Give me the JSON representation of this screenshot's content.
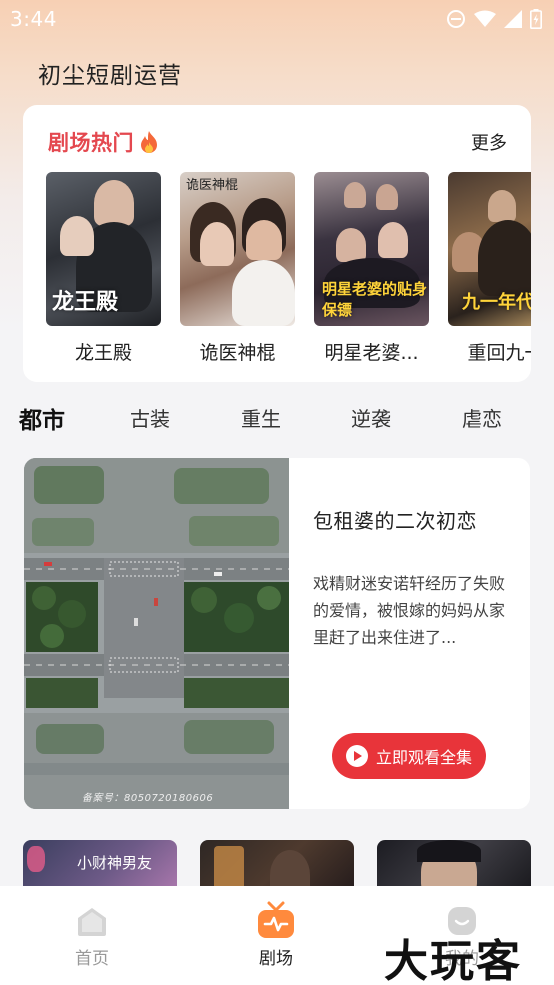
{
  "status_bar": {
    "time": "3:44"
  },
  "header": {
    "title": "初尘短剧运营"
  },
  "hot_section": {
    "title": "剧场热门",
    "more_label": "更多",
    "items": [
      {
        "name": "龙王殿",
        "poster_text": "龙王殿"
      },
      {
        "name": "诡医神棍",
        "poster_text": "诡医神棍"
      },
      {
        "name": "明星老婆...",
        "poster_text": "明星老婆的贴身保镖"
      },
      {
        "name": "重回九一",
        "poster_text": "九一年代"
      }
    ]
  },
  "tabs": [
    {
      "label": "都市",
      "active": true
    },
    {
      "label": "古装",
      "active": false
    },
    {
      "label": "重生",
      "active": false
    },
    {
      "label": "逆袭",
      "active": false
    },
    {
      "label": "虐恋",
      "active": false
    }
  ],
  "feature": {
    "title": "包租婆的二次初恋",
    "description": "戏精财迷安诺轩经历了失败的爱情，被恨嫁的妈妈从家里赶了出来住进了...",
    "button_label": "立即观看全集",
    "image_caption": "备案号：8050720180606"
  },
  "thumbs": [
    {
      "text": "小财神男友"
    },
    {
      "text": ""
    },
    {
      "text": ""
    }
  ],
  "bottom_nav": [
    {
      "label": "首页",
      "icon": "home-icon",
      "active": false
    },
    {
      "label": "剧场",
      "icon": "theater-icon",
      "active": true
    },
    {
      "label": "我的",
      "icon": "profile-icon",
      "active": false
    }
  ],
  "watermark": "大玩客",
  "colors": {
    "accent": "#e8343a",
    "hot_title": "#e4484f",
    "nav_active": "#ff8a3d"
  }
}
